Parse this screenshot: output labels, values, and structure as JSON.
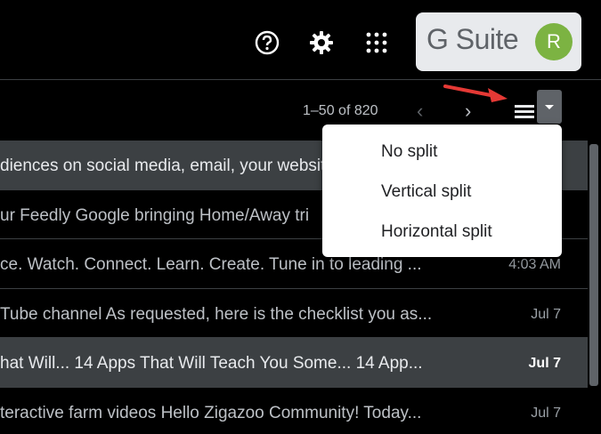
{
  "header": {
    "icons": [
      "help-icon",
      "settings-icon",
      "apps-icon"
    ],
    "gsuite_label": "G Suite",
    "avatar_initial": "R",
    "avatar_color": "#7cb342"
  },
  "toolbar": {
    "range_text": "1–50 of 820",
    "prev_glyph": "‹",
    "next_glyph": "›"
  },
  "split_menu": {
    "items": [
      "No split",
      "Vertical split",
      "Horizontal split"
    ]
  },
  "emails": [
    {
      "snippet": "diences on social media, email, your website",
      "time": "",
      "selected": true,
      "bold": false
    },
    {
      "snippet": "ur Feedly Google bringing Home/Away tri",
      "time": "",
      "selected": false,
      "bold": false
    },
    {
      "snippet": "ce. Watch. Connect. Learn. Create. Tune in to leading ...",
      "time": "4:03 AM",
      "selected": false,
      "bold": false
    },
    {
      "snippet": "Tube channel As requested, here is the checklist you as...",
      "time": "Jul 7",
      "selected": false,
      "bold": false
    },
    {
      "snippet": "hat Will... 14 Apps That Will Teach You Some... 14 App...",
      "time": "Jul 7",
      "selected": true,
      "bold": true
    },
    {
      "snippet": "teractive farm videos Hello Zigazoo Community! Today...",
      "time": "Jul 7",
      "selected": false,
      "bold": false
    }
  ],
  "colors": {
    "annotation_arrow": "#e53935"
  }
}
